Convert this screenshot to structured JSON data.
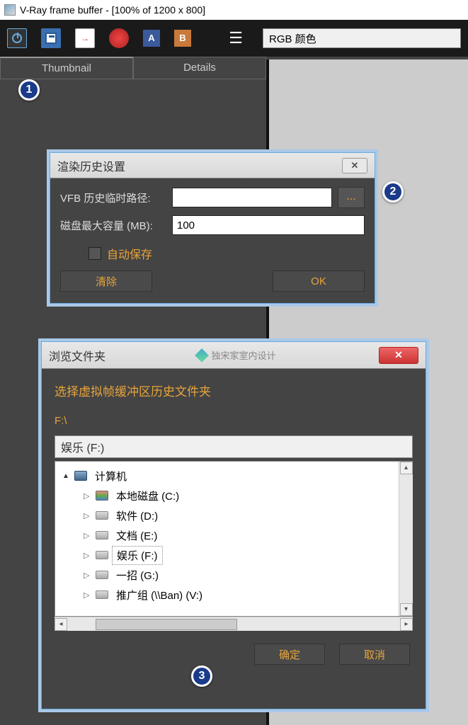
{
  "window": {
    "title": "V-Ray frame buffer - [100% of 1200 x 800]"
  },
  "toolbar": {
    "channel": "RGB 颜色"
  },
  "tabs": {
    "thumbnail": "Thumbnail",
    "details": "Details"
  },
  "settings_dialog": {
    "title": "渲染历史设置",
    "path_label": "VFB 历史临时路径:",
    "path_value": "",
    "capacity_label": "磁盘最大容量 (MB):",
    "capacity_value": "100",
    "browse_btn": "...",
    "autosave_label": "自动保存",
    "clear_btn": "清除",
    "ok_btn": "OK"
  },
  "browse_dialog": {
    "title": "浏览文件夹",
    "logo_text": "独宋家室内设计",
    "prompt": "选择虚拟帧缓冲区历史文件夹",
    "current_path": "F:\\",
    "path_input": "娱乐 (F:)",
    "tree": {
      "root": "计算机",
      "items": [
        {
          "label": "本地磁盘 (C:)",
          "icon": "windisk"
        },
        {
          "label": "软件 (D:)",
          "icon": "disk"
        },
        {
          "label": "文档 (E:)",
          "icon": "disk"
        },
        {
          "label": "娱乐 (F:)",
          "icon": "disk",
          "selected": true
        },
        {
          "label": "一招 (G:)",
          "icon": "disk"
        },
        {
          "label": "推广组 (\\\\Ban) (V:)",
          "icon": "disk"
        }
      ]
    },
    "ok_btn": "确定",
    "cancel_btn": "取消"
  },
  "badges": {
    "one": "1",
    "two": "2",
    "three": "3"
  }
}
